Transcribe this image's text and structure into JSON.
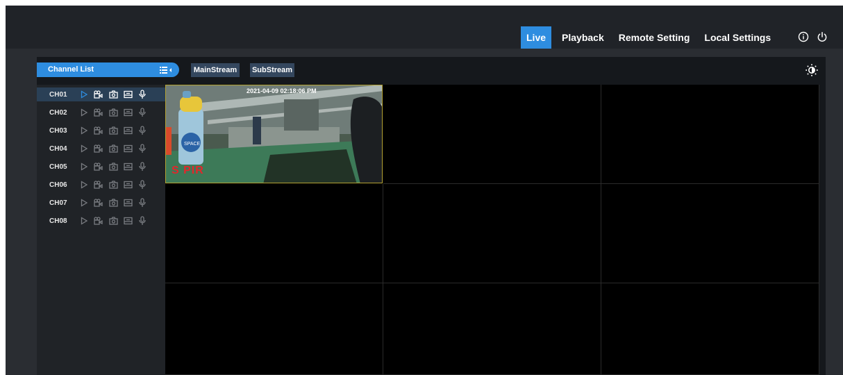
{
  "nav": {
    "items": [
      "Live",
      "Playback",
      "Remote Setting",
      "Local Settings"
    ],
    "active": "Live"
  },
  "channel_list": {
    "title": "Channel List",
    "channels": [
      "CH01",
      "CH02",
      "CH03",
      "CH04",
      "CH05",
      "CH06",
      "CH07",
      "CH08"
    ],
    "selected": "CH01"
  },
  "streams": {
    "main": "MainStream",
    "sub": "SubStream"
  },
  "camera": {
    "timestamp": "2021-04-09 02:18:06 PM",
    "overlay": "S PIR"
  },
  "colors": {
    "accent": "#2e8de0",
    "background": "#2a2d32",
    "topbar": "#202328",
    "pir": "#e3262b"
  },
  "icons": [
    "info-icon",
    "power-icon",
    "list-toggle-icon",
    "brightness-icon",
    "play-icon",
    "record-icon",
    "snapshot-icon",
    "playback-icon",
    "microphone-icon"
  ]
}
